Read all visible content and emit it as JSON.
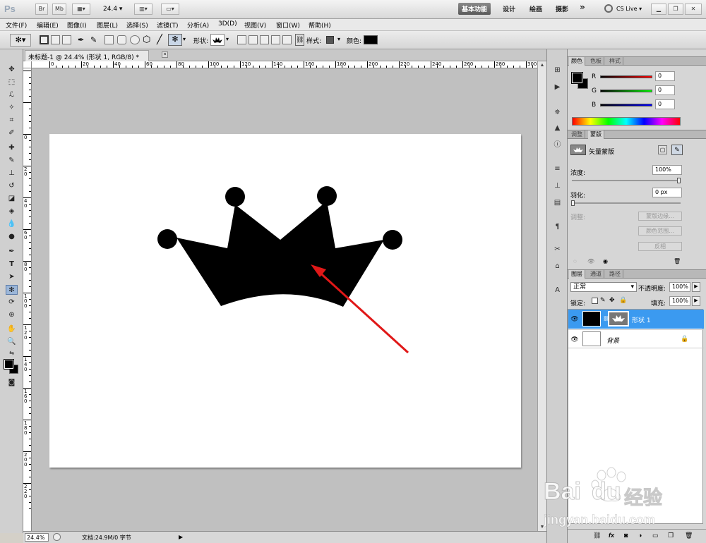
{
  "app": {
    "logo": "Ps",
    "bridge_button": "Br",
    "minibridge_button": "Mb",
    "zoom_value": "24.4",
    "workspaces": [
      "基本功能",
      "设计",
      "绘画",
      "摄影"
    ],
    "more": "»",
    "cslive": "CS Live"
  },
  "menu": [
    "文件(F)",
    "编辑(E)",
    "图像(I)",
    "图层(L)",
    "选择(S)",
    "滤镜(T)",
    "分析(A)",
    "3D(D)",
    "视图(V)",
    "窗口(W)",
    "帮助(H)"
  ],
  "options": {
    "shape_label": "形状:",
    "style_label": "样式:",
    "color_label": "颜色:",
    "color": "#000000"
  },
  "document": {
    "tab_title": "未标题-1 @ 24.4% (形状 1, RGB/8) *",
    "close": "×",
    "ruler_h_ticks": [
      "0",
      "20",
      "40",
      "60",
      "80",
      "100",
      "120",
      "140",
      "160",
      "180",
      "200",
      "220",
      "240",
      "260",
      "280",
      "300"
    ],
    "ruler_v_ticks": [
      "0",
      "20",
      "40",
      "60",
      "80",
      "100",
      "120",
      "140",
      "160",
      "180",
      "200",
      "220"
    ]
  },
  "status": {
    "zoom": "24.4%",
    "doc_info": "文档:24.9M/0 字节"
  },
  "color_panel": {
    "tabs": [
      "颜色",
      "色板",
      "样式"
    ],
    "channels": [
      {
        "label": "R",
        "value": "0"
      },
      {
        "label": "G",
        "value": "0"
      },
      {
        "label": "B",
        "value": "0"
      }
    ]
  },
  "masks_panel": {
    "tabs": [
      "调整",
      "蒙版"
    ],
    "mask_type": "矢量蒙版",
    "density_label": "浓度:",
    "density_value": "100%",
    "feather_label": "羽化:",
    "feather_value": "0 px",
    "refine_label": "调整:",
    "edge_button": "蒙版边缘...",
    "color_range_button": "颜色范围...",
    "invert_button": "反相"
  },
  "layers_panel": {
    "tabs": [
      "图层",
      "通道",
      "路径"
    ],
    "blend_mode": "正常",
    "opacity_label": "不透明度:",
    "opacity_value": "100%",
    "lock_label": "锁定:",
    "fill_label": "填充:",
    "fill_value": "100%",
    "layers": [
      {
        "name": "形状 1",
        "selected": true
      },
      {
        "name": "背景",
        "selected": false
      }
    ]
  },
  "watermark": {
    "brand": "Bai",
    "brand2": "du",
    "chinese": "经验",
    "url": "jingyan.baidu.com"
  },
  "colors": {
    "accent_selected": "#3b9af0",
    "arrow": "#e01818",
    "crown": "#000000"
  }
}
